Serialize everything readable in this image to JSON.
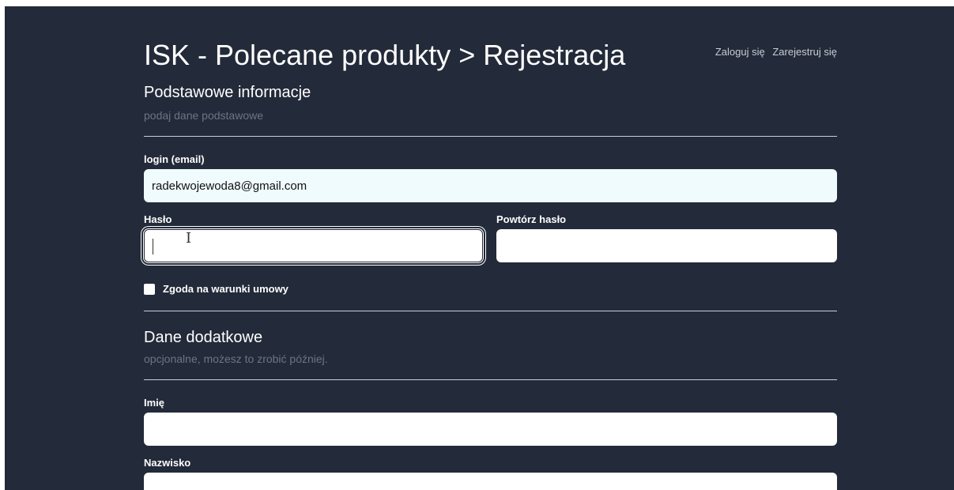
{
  "header": {
    "title": "ISK - Polecane produkty > Rejestracja",
    "login_link": "Zaloguj się",
    "register_link": "Zarejestruj się"
  },
  "basic_section": {
    "title": "Podstawowe informacje",
    "subtitle": "podaj dane podstawowe"
  },
  "form": {
    "login_label": "login (email)",
    "login_value": "radekwojewoda8@gmail.com",
    "password_label": "Hasło",
    "password_value": "",
    "repeat_password_label": "Powtórz hasło",
    "repeat_password_value": "",
    "terms_label": "Zgoda na warunki umowy",
    "terms_checked": false
  },
  "extra_section": {
    "title": "Dane dodatkowe",
    "subtitle": "opcjonalne, możesz to zrobić później."
  },
  "extra_form": {
    "first_name_label": "Imię",
    "first_name_value": "",
    "last_name_label": "Nazwisko",
    "last_name_value": ""
  },
  "colors": {
    "background": "#232a39",
    "text": "#ffffff",
    "muted": "#6d7585",
    "input_filled": "#f0fbfd"
  },
  "icons": {
    "cursor": "text-cursor-ibeam-icon"
  }
}
